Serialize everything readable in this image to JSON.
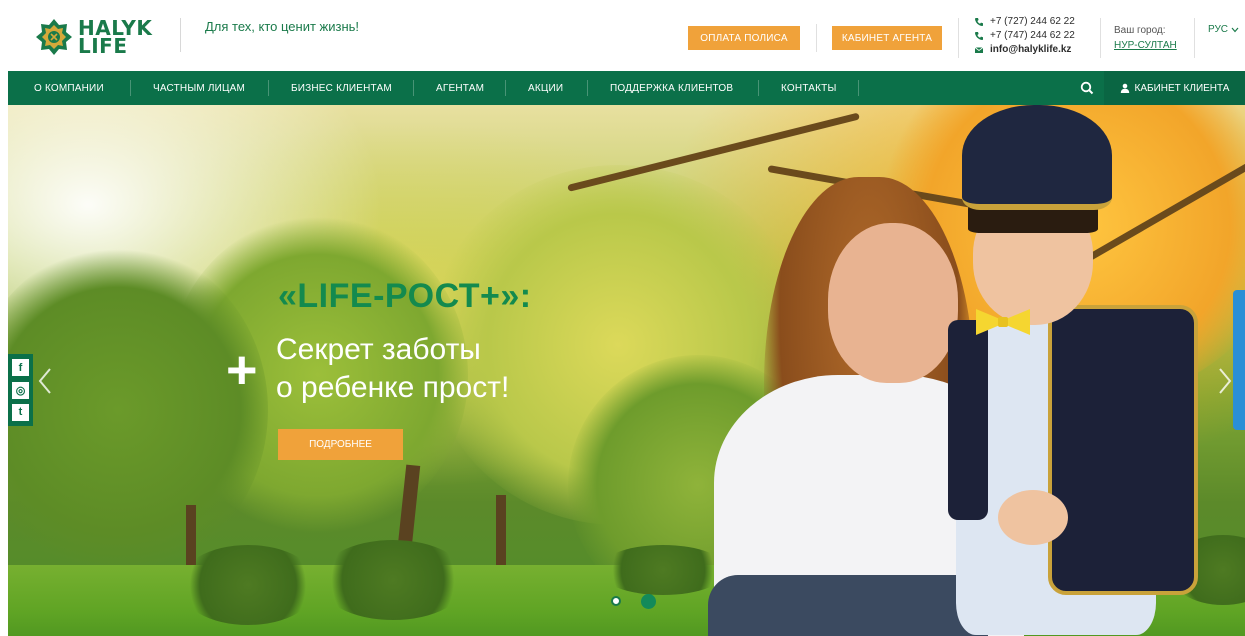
{
  "header": {
    "logo": {
      "line1": "HALYK",
      "line2": "LIFE"
    },
    "slogan": "Для тех, кто ценит жизнь!",
    "pay_button": "Оплата полиса",
    "agent_button": "Кабинет агента",
    "contacts": {
      "phone1": "+7 (727) 244 62 22",
      "phone2": "+7 (747) 244 62 22",
      "email": "info@halyklife.kz"
    },
    "city_label": "Ваш город:",
    "city_value": "НУР-СУЛТАН",
    "language": "РУС"
  },
  "nav": {
    "items": [
      {
        "label": "О компании"
      },
      {
        "label": "Частным лицам"
      },
      {
        "label": "Бизнес клиентам"
      },
      {
        "label": "Агентам"
      },
      {
        "label": "Акции"
      },
      {
        "label": "Поддержка клиентов"
      },
      {
        "label": "Контакты"
      }
    ],
    "cabinet": "Кабинет клиента"
  },
  "hero": {
    "title": "«LIFE-РОСТ+»:",
    "subtitle_line1": "Секрет заботы",
    "subtitle_line2": "о ребенке прост!",
    "plus": "+",
    "button": "Подробнее"
  },
  "social": [
    {
      "icon": "facebook-icon",
      "glyph": "f"
    },
    {
      "icon": "instagram-icon",
      "glyph": "◎"
    },
    {
      "icon": "twitter-icon",
      "glyph": "t"
    }
  ],
  "colors": {
    "brand_green": "#0b7049",
    "accent_orange": "#f0a23a",
    "title_green": "#138a4e",
    "side_tab_blue": "#2a8fd6"
  },
  "slider": {
    "total": 2,
    "active": 2
  }
}
